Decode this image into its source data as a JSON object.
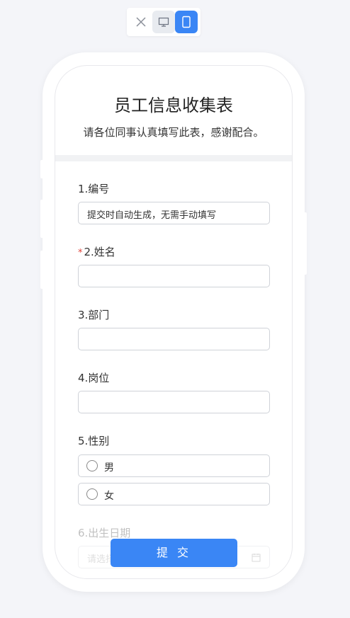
{
  "form": {
    "title": "员工信息收集表",
    "subtitle": "请各位同事认真填写此表，感谢配合。",
    "fields": [
      {
        "label": "1.编号",
        "value": "提交时自动生成，无需手动填写"
      },
      {
        "label": "2.姓名",
        "required": true,
        "value": ""
      },
      {
        "label": "3.部门",
        "value": ""
      },
      {
        "label": "4.岗位",
        "value": ""
      },
      {
        "label": "5.性别",
        "options": [
          "男",
          "女"
        ],
        "selected": null
      },
      {
        "label": "6.出生日期",
        "placeholder": "请选择"
      }
    ],
    "required_mark": "*",
    "submit_label": "提 交"
  },
  "colors": {
    "accent": "#3a86f5",
    "required": "#e0433b"
  },
  "icons": [
    "close-icon",
    "desktop-icon",
    "mobile-icon",
    "calendar-icon"
  ]
}
